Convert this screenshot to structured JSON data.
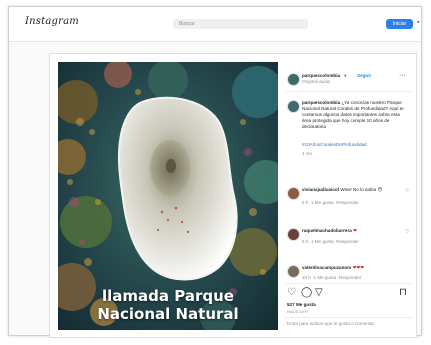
{
  "topbar": {
    "logo": "Instagram",
    "search_placeholder": "Buscar",
    "button_label": "Iniciar"
  },
  "post": {
    "overlay_line1": "llamada Parque",
    "overlay_line2": "Nacional Natural",
    "author": "parquescolombia",
    "follow": "Seguir",
    "audio": "Original audio",
    "caption_author": "parquescolombia",
    "caption": "¿Ya conocías nuestro Parque Nacional Natural Corales de Profundidad? Aquí te contamos algunos datos importantes sobre esta área protegida que hoy cumple 10 años de declaratoria",
    "hashtag": "#10AñosCoralesDeProfundidad",
    "caption_time": "1 sm",
    "comments": [
      {
        "user": "vivianajudiuaicol",
        "text": "Wow! No lo sabía",
        "meta_time": "8 h",
        "meta_likes": "1 Me gusta",
        "meta_reply": "Responder",
        "emoji": "😯"
      },
      {
        "user": "raquelmachadobarrera",
        "text": "",
        "meta_time": "6 h",
        "meta_likes": "1 Me gusta",
        "meta_reply": "Responder",
        "emoji": "❤"
      },
      {
        "user": "valentinacampuzanom",
        "text": "",
        "meta_time": "10 h",
        "meta_likes": "1 Me gusta",
        "meta_reply": "Responder",
        "emoji": "❤❤❤"
      }
    ],
    "likes": "527 Me gusta",
    "date": "HACE 14 H",
    "login_prompt": "Entra para indicar que te gusta o comentar."
  },
  "colors": {
    "accent": "#2f7fe6",
    "link": "#0095f6",
    "heart": "#c9202d"
  },
  "icons": [
    "more-icon",
    "heart-icon",
    "comment-icon",
    "share-icon",
    "bookmark-icon",
    "verified-icon"
  ]
}
